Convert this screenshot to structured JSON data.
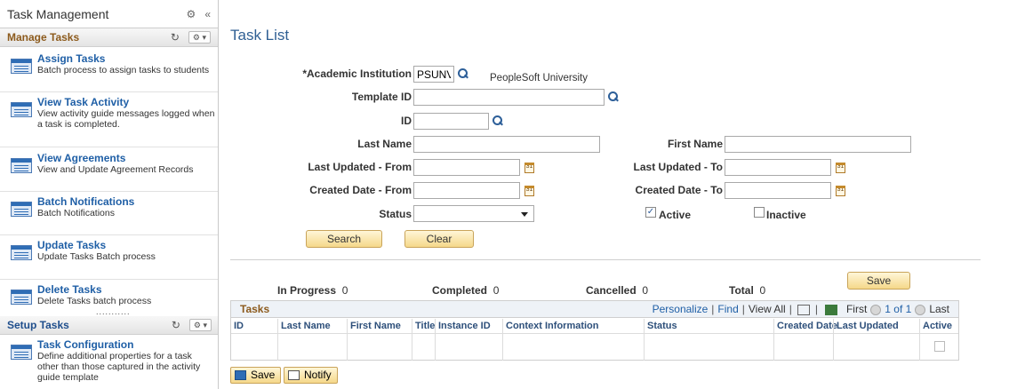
{
  "sidebar": {
    "title": "Task Management",
    "sections": [
      {
        "title": "Manage Tasks"
      },
      {
        "title": "Setup Tasks"
      }
    ],
    "items": [
      {
        "title": "Assign Tasks",
        "desc": "Batch process to assign tasks to students"
      },
      {
        "title": "View Task Activity",
        "desc": "View activity guide messages logged when a task is completed."
      },
      {
        "title": "View Agreements",
        "desc": "View and Update Agreement Records"
      },
      {
        "title": "Batch Notifications",
        "desc": "Batch Notifications"
      },
      {
        "title": "Update Tasks",
        "desc": "Update Tasks Batch process"
      },
      {
        "title": "Delete Tasks",
        "desc": "Delete Tasks batch process"
      },
      {
        "title": "Task Configuration",
        "desc": "Define additional properties for a task other than those captured in the activity guide template"
      }
    ],
    "dots": "..........."
  },
  "page": {
    "title": "Task List"
  },
  "form": {
    "academic_institution_label": "*Academic Institution",
    "academic_institution_value": "PSUNV",
    "academic_institution_desc": "PeopleSoft University",
    "template_id_label": "Template ID",
    "id_label": "ID",
    "last_name_label": "Last Name",
    "first_name_label": "First Name",
    "last_updated_from_label": "Last Updated - From",
    "last_updated_to_label": "Last Updated - To",
    "created_date_from_label": "Created Date - From",
    "created_date_to_label": "Created Date - To",
    "status_label": "Status",
    "active_label": "Active",
    "inactive_label": "Inactive",
    "active_checked": true,
    "inactive_checked": false,
    "search_label": "Search",
    "clear_label": "Clear"
  },
  "counts": {
    "in_progress_label": "In Progress",
    "in_progress_value": "0",
    "completed_label": "Completed",
    "completed_value": "0",
    "cancelled_label": "Cancelled",
    "cancelled_value": "0",
    "total_label": "Total",
    "total_value": "0",
    "save_label": "Save"
  },
  "grid": {
    "title": "Tasks",
    "personalize": "Personalize",
    "find": "Find",
    "view_all": "View All",
    "first": "First",
    "range": "1 of 1",
    "last": "Last",
    "columns": [
      "ID",
      "Last Name",
      "First Name",
      "Title",
      "Instance ID",
      "Context Information",
      "Status",
      "Created Date",
      "Last Updated",
      "Active"
    ]
  },
  "footer": {
    "save_label": "Save",
    "notify_label": "Notify"
  },
  "colors": {
    "section_title": "#8c5a1c",
    "link": "#1f5fa6",
    "button_bg": "#f5d88a"
  }
}
